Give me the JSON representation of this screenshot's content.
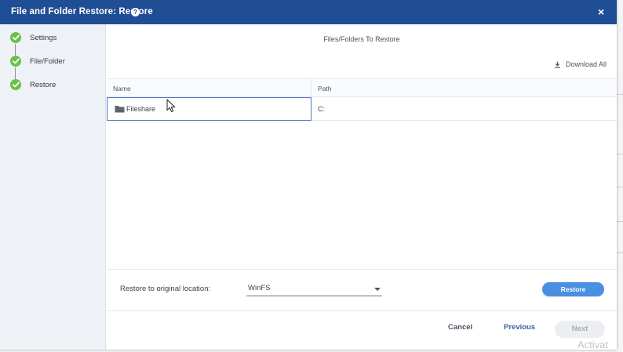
{
  "dialog": {
    "title": "File and Folder Restore: Restore",
    "help_icon": "question-circle-icon",
    "close_icon": "close-icon",
    "close_glyph": "×"
  },
  "steps": [
    {
      "label": "Settings",
      "status": "complete"
    },
    {
      "label": "File/Folder",
      "status": "complete"
    },
    {
      "label": "Restore",
      "status": "complete"
    }
  ],
  "panel": {
    "heading": "Files/Folders To Restore",
    "download_all_label": "Download All",
    "download_icon": "download-icon"
  },
  "table": {
    "columns": [
      "Name",
      "Path"
    ],
    "rows": [
      {
        "name": "Fileshare",
        "icon": "folder-icon",
        "path": "C:"
      }
    ]
  },
  "restore_options": {
    "label": "Restore to original location:",
    "selected_location": "WinFS",
    "restore_button": "Restore"
  },
  "footer": {
    "cancel": "Cancel",
    "previous": "Previous",
    "next": "Next"
  },
  "watermark": "Activat",
  "colors": {
    "title_bar": "#1f4e94",
    "step_complete": "#6cc04a",
    "primary_button": "#4a90e2",
    "link_blue": "#3b5fa6",
    "selected_cell_border": "#4a78c5"
  }
}
